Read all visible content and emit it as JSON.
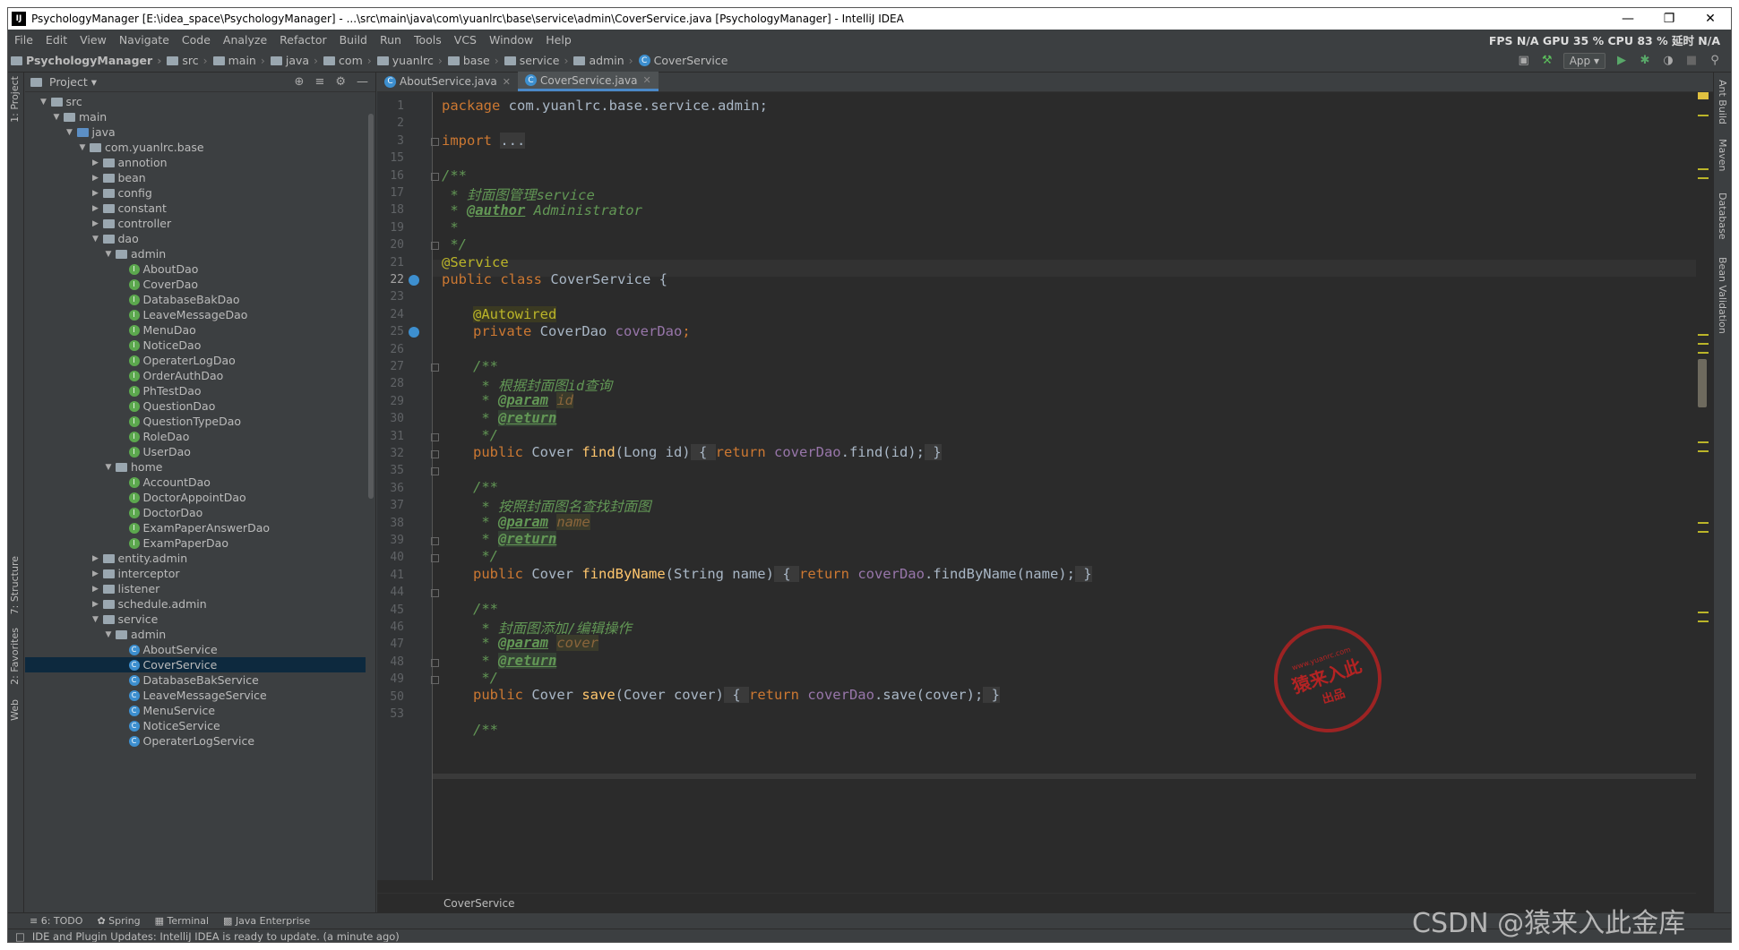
{
  "window": {
    "title": "PsychologyManager [E:\\idea_space\\PsychologyManager] - ...\\src\\main\\java\\com\\yuanlrc\\base\\service\\admin\\CoverService.java [PsychologyManager] - IntelliJ IDEA",
    "app_icon": "IJ"
  },
  "menu": {
    "items": [
      "File",
      "Edit",
      "View",
      "Navigate",
      "Code",
      "Analyze",
      "Refactor",
      "Build",
      "Run",
      "Tools",
      "VCS",
      "Window",
      "Help"
    ],
    "perf": "FPS N/A GPU 35 % CPU 83 % 延时 N/A"
  },
  "breadcrumbs": [
    "PsychologyManager",
    "src",
    "main",
    "java",
    "com",
    "yuanlrc",
    "base",
    "service",
    "admin",
    "CoverService"
  ],
  "run_config": "App",
  "project_panel": {
    "title": "Project",
    "tree": [
      {
        "label": "src",
        "indent": 1,
        "open": true,
        "kind": "folder"
      },
      {
        "label": "main",
        "indent": 2,
        "open": true,
        "kind": "folder"
      },
      {
        "label": "java",
        "indent": 3,
        "open": true,
        "kind": "src"
      },
      {
        "label": "com.yuanlrc.base",
        "indent": 4,
        "open": true,
        "kind": "folder"
      },
      {
        "label": "annotion",
        "indent": 5,
        "open": false,
        "kind": "folder"
      },
      {
        "label": "bean",
        "indent": 5,
        "open": false,
        "kind": "folder"
      },
      {
        "label": "config",
        "indent": 5,
        "open": false,
        "kind": "folder"
      },
      {
        "label": "constant",
        "indent": 5,
        "open": false,
        "kind": "folder"
      },
      {
        "label": "controller",
        "indent": 5,
        "open": false,
        "kind": "folder"
      },
      {
        "label": "dao",
        "indent": 5,
        "open": true,
        "kind": "folder"
      },
      {
        "label": "admin",
        "indent": 6,
        "open": true,
        "kind": "folder"
      },
      {
        "label": "AboutDao",
        "indent": 7,
        "kind": "interface"
      },
      {
        "label": "CoverDao",
        "indent": 7,
        "kind": "interface"
      },
      {
        "label": "DatabaseBakDao",
        "indent": 7,
        "kind": "interface"
      },
      {
        "label": "LeaveMessageDao",
        "indent": 7,
        "kind": "interface"
      },
      {
        "label": "MenuDao",
        "indent": 7,
        "kind": "interface"
      },
      {
        "label": "NoticeDao",
        "indent": 7,
        "kind": "interface"
      },
      {
        "label": "OperaterLogDao",
        "indent": 7,
        "kind": "interface"
      },
      {
        "label": "OrderAuthDao",
        "indent": 7,
        "kind": "interface"
      },
      {
        "label": "PhTestDao",
        "indent": 7,
        "kind": "interface"
      },
      {
        "label": "QuestionDao",
        "indent": 7,
        "kind": "interface"
      },
      {
        "label": "QuestionTypeDao",
        "indent": 7,
        "kind": "interface"
      },
      {
        "label": "RoleDao",
        "indent": 7,
        "kind": "interface"
      },
      {
        "label": "UserDao",
        "indent": 7,
        "kind": "interface"
      },
      {
        "label": "home",
        "indent": 6,
        "open": true,
        "kind": "folder"
      },
      {
        "label": "AccountDao",
        "indent": 7,
        "kind": "interface"
      },
      {
        "label": "DoctorAppointDao",
        "indent": 7,
        "kind": "interface"
      },
      {
        "label": "DoctorDao",
        "indent": 7,
        "kind": "interface"
      },
      {
        "label": "ExamPaperAnswerDao",
        "indent": 7,
        "kind": "interface"
      },
      {
        "label": "ExamPaperDao",
        "indent": 7,
        "kind": "interface"
      },
      {
        "label": "entity.admin",
        "indent": 5,
        "open": false,
        "kind": "folder"
      },
      {
        "label": "interceptor",
        "indent": 5,
        "open": false,
        "kind": "folder"
      },
      {
        "label": "listener",
        "indent": 5,
        "open": false,
        "kind": "folder"
      },
      {
        "label": "schedule.admin",
        "indent": 5,
        "open": false,
        "kind": "folder"
      },
      {
        "label": "service",
        "indent": 5,
        "open": true,
        "kind": "folder"
      },
      {
        "label": "admin",
        "indent": 6,
        "open": true,
        "kind": "folder"
      },
      {
        "label": "AboutService",
        "indent": 7,
        "kind": "class"
      },
      {
        "label": "CoverService",
        "indent": 7,
        "kind": "class",
        "selected": true
      },
      {
        "label": "DatabaseBakService",
        "indent": 7,
        "kind": "class"
      },
      {
        "label": "LeaveMessageService",
        "indent": 7,
        "kind": "class"
      },
      {
        "label": "MenuService",
        "indent": 7,
        "kind": "class"
      },
      {
        "label": "NoticeService",
        "indent": 7,
        "kind": "class"
      },
      {
        "label": "OperaterLogService",
        "indent": 7,
        "kind": "class"
      }
    ]
  },
  "editor": {
    "tabs": [
      {
        "label": "AboutService.java",
        "active": false
      },
      {
        "label": "CoverService.java",
        "active": true
      }
    ],
    "line_numbers": [
      "1",
      "2",
      "3",
      "15",
      "16",
      "17",
      "18",
      "19",
      "20",
      "21",
      "22",
      "23",
      "24",
      "25",
      "26",
      "27",
      "28",
      "29",
      "30",
      "31",
      "32",
      "35",
      "36",
      "37",
      "38",
      "39",
      "40",
      "41",
      "44",
      "45",
      "46",
      "47",
      "48",
      "49",
      "50",
      "53"
    ],
    "current_line": "22",
    "code": {
      "l1_kw": "package",
      "l1_rest": " com.yuanlrc.base.service.admin;",
      "l3_kw": "import",
      "l3_fold": "...",
      "l16": "/**",
      "l17": " * 封面图管理service",
      "l18_star": " * ",
      "l18_tag": "@author",
      "l18_rest": " Administrator",
      "l19": " *",
      "l20": " */",
      "l21": "@Service",
      "l22_kw": "public class ",
      "l22_name": "CoverService",
      "l22_rest": " {",
      "l24": "@Autowired",
      "l25_kw": "private ",
      "l25_type": "CoverDao ",
      "l25_field": "coverDao",
      "l25_end": ";",
      "l27": "/**",
      "l28": " * 根据封面图id查询",
      "l29_star": " * ",
      "l29_tag": "@param",
      "l29_p": "id",
      "l30_star": " * ",
      "l30_tag": "@return",
      "l31": " */",
      "l32_kw": "public ",
      "l32_type": "Cover ",
      "l32_fn": "find",
      "l32_args": "(Long id)",
      "l32_ob": " { ",
      "l32_ret": "return ",
      "l32_field": "coverDao",
      "l32_call": ".find(id);",
      "l32_cb": " }",
      "l36": "/**",
      "l37": " * 按照封面图名查找封面图",
      "l38_star": " * ",
      "l38_tag": "@param",
      "l38_p": "name",
      "l39_star": " * ",
      "l39_tag": "@return",
      "l40": " */",
      "l41_kw": "public ",
      "l41_type": "Cover ",
      "l41_fn": "findByName",
      "l41_args": "(String name)",
      "l41_ob": " { ",
      "l41_ret": "return ",
      "l41_field": "coverDao",
      "l41_call": ".findByName(name);",
      "l41_cb": " }",
      "l45": "/**",
      "l46": " * 封面图添加/编辑操作",
      "l47_star": " * ",
      "l47_tag": "@param",
      "l47_p": "cover",
      "l48_star": " * ",
      "l48_tag": "@return",
      "l49": " */",
      "l50_kw": "public ",
      "l50_type": "Cover ",
      "l50_fn": "save",
      "l50_args": "(Cover cover)",
      "l50_ob": " { ",
      "l50_ret": "return ",
      "l50_field": "coverDao",
      "l50_call": ".save(cover);",
      "l50_cb": " }",
      "l53": "/**"
    },
    "breadcrumb_bottom": "CoverService"
  },
  "left_tool_tabs": [
    "1: Project",
    "7: Structure",
    "2: Favorites",
    "Web"
  ],
  "right_tool_tabs": [
    "Ant Build",
    "Maven",
    "Database",
    "Bean Validation"
  ],
  "bottom_tool_tabs": [
    "6: TODO",
    "Spring",
    "Terminal",
    "Java Enterprise"
  ],
  "status_text": "IDE and Plugin Updates: IntelliJ IDEA is ready to update. (a minute ago)",
  "watermark": "CSDN @猿来入此金库",
  "seal": {
    "top": "www.yuanrc.com",
    "middle": "猿来入此",
    "bottom": "出品"
  },
  "colors": {
    "keyword": "#cc7832",
    "comment": "#629755",
    "annotation": "#bbb529",
    "field": "#9876aa",
    "method": "#ffc66d",
    "background": "#2b2b2b",
    "selection": "#0d293e"
  }
}
